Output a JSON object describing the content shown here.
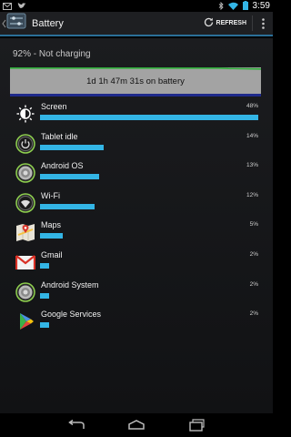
{
  "statusbar": {
    "time": "3:59",
    "left_icons": [
      "gmail-notification-icon",
      "twitter-notification-icon"
    ],
    "right_icons": [
      "bluetooth-icon",
      "wifi-icon",
      "battery-icon"
    ]
  },
  "actionbar": {
    "title": "Battery",
    "refresh_label": "REFRESH",
    "accent_color": "#2b6f98"
  },
  "battery": {
    "status": "92% - Not charging",
    "graph_label": "1d 1h 47m 31s on battery",
    "level_fraction": 0.92
  },
  "usage": [
    {
      "name": "Screen",
      "pct": "48%",
      "value": 48,
      "icon": "brightness-icon"
    },
    {
      "name": "Tablet idle",
      "pct": "14%",
      "value": 14,
      "icon": "power-icon"
    },
    {
      "name": "Android OS",
      "pct": "13%",
      "value": 13,
      "icon": "android-os-icon"
    },
    {
      "name": "Wi-Fi",
      "pct": "12%",
      "value": 12,
      "icon": "wifi-icon"
    },
    {
      "name": "Maps",
      "pct": "5%",
      "value": 5,
      "icon": "maps-icon"
    },
    {
      "name": "Gmail",
      "pct": "2%",
      "value": 2,
      "icon": "gmail-icon"
    },
    {
      "name": "Android System",
      "pct": "2%",
      "value": 2,
      "icon": "android-system-icon"
    },
    {
      "name": "Google Services",
      "pct": "2%",
      "value": 2,
      "icon": "google-services-icon"
    }
  ],
  "navbar": {
    "icons": [
      "back-icon",
      "home-icon",
      "recent-apps-icon"
    ]
  }
}
